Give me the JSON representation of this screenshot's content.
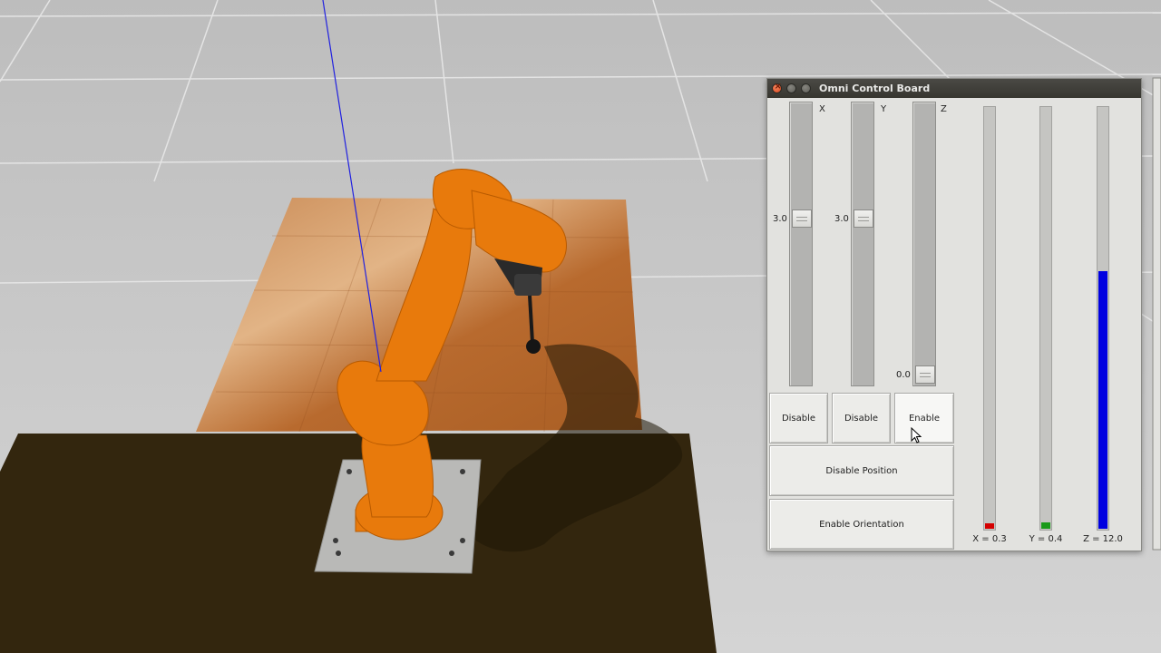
{
  "window": {
    "title": "Omni Control Board"
  },
  "position_sliders": [
    {
      "axis": "X",
      "value_text": "3.0",
      "level": 0.6
    },
    {
      "axis": "Y",
      "value_text": "3.0",
      "level": 0.6
    },
    {
      "axis": "Z",
      "value_text": "0.0",
      "level": 0.0
    }
  ],
  "axis_buttons": {
    "x": "Disable",
    "y": "Disable",
    "z": "Enable"
  },
  "buttons": {
    "position": "Disable Position",
    "orientation": "Enable Orientation"
  },
  "orientation_bars": [
    {
      "label": "X = 0.3",
      "color": "#d40000",
      "level": 0.012
    },
    {
      "label": "Y = 0.4",
      "color": "#1a9a1a",
      "level": 0.015
    },
    {
      "label": "Z = 12.0",
      "color": "#0000e0",
      "level": 0.61
    }
  ],
  "scene": {
    "robot_color": "#e87a0c",
    "floor_color": "#c9c9c9",
    "table_top_color": "#b86a2e",
    "base_table_color": "#33260e",
    "axis_line_color": "#2020e0"
  }
}
